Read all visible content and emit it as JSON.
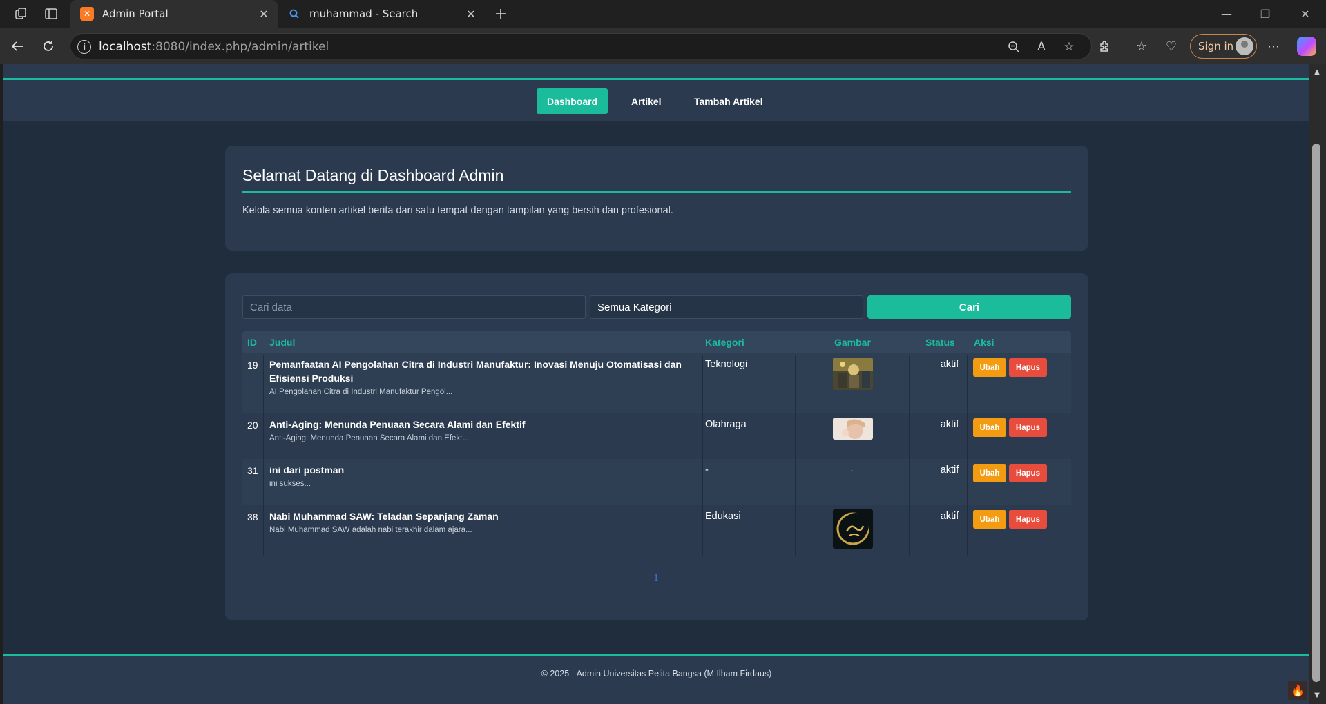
{
  "browser": {
    "tabs": [
      {
        "title": "Admin Portal",
        "active": true,
        "favicon": "xampp-icon"
      },
      {
        "title": "muhammad - Search",
        "active": false,
        "favicon": "search-icon"
      }
    ],
    "url": {
      "host": "localhost",
      "path": ":8080/index.php/admin/artikel"
    },
    "signin_label": "Sign in"
  },
  "nav": {
    "items": [
      "Dashboard",
      "Artikel",
      "Tambah Artikel"
    ],
    "active": "Dashboard"
  },
  "welcome": {
    "title": "Selamat Datang di Dashboard Admin",
    "text": "Kelola semua konten artikel berita dari satu tempat dengan tampilan yang bersih dan profesional."
  },
  "search": {
    "placeholder": "Cari data",
    "category_selected": "Semua Kategori",
    "button_label": "Cari"
  },
  "table": {
    "headers": [
      "ID",
      "Judul",
      "Kategori",
      "Gambar",
      "Status",
      "Aksi"
    ],
    "rows": [
      {
        "id": "19",
        "title": "Pemanfaatan AI Pengolahan Citra di Industri Manufaktur: Inovasi Menuju Otomatisasi dan Efisiensi Produksi",
        "excerpt": "AI Pengolahan Citra di Industri Manufaktur Pengol...",
        "category": "Teknologi",
        "image": "ai-manufacturing-thumbnail",
        "status": "aktif"
      },
      {
        "id": "20",
        "title": "Anti-Aging: Menunda Penuaan Secara Alami dan Efektif",
        "excerpt": "Anti-Aging: Menunda Penuaan Secara Alami dan Efekt...",
        "category": "Olahraga",
        "image": "anti-aging-thumbnail",
        "status": "aktif"
      },
      {
        "id": "31",
        "title": "ini dari postman",
        "excerpt": "ini sukses...",
        "category": "-",
        "image": "-",
        "status": "aktif"
      },
      {
        "id": "38",
        "title": "Nabi Muhammad SAW: Teladan Sepanjang Zaman",
        "excerpt": "Nabi Muhammad SAW adalah nabi terakhir dalam ajara...",
        "category": "Edukasi",
        "image": "calligraphy-thumbnail",
        "status": "aktif"
      }
    ],
    "edit_label": "Ubah",
    "delete_label": "Hapus"
  },
  "pagination": {
    "current": "1"
  },
  "footer": {
    "text": "© 2025 - Admin Universitas Pelita Bangsa (M Ilham Firdaus)"
  },
  "colors": {
    "accent": "#1abc9c",
    "edit": "#f39c12",
    "delete": "#e74c3c",
    "background": "#1f2d3d",
    "card": "#2b3a4e"
  }
}
